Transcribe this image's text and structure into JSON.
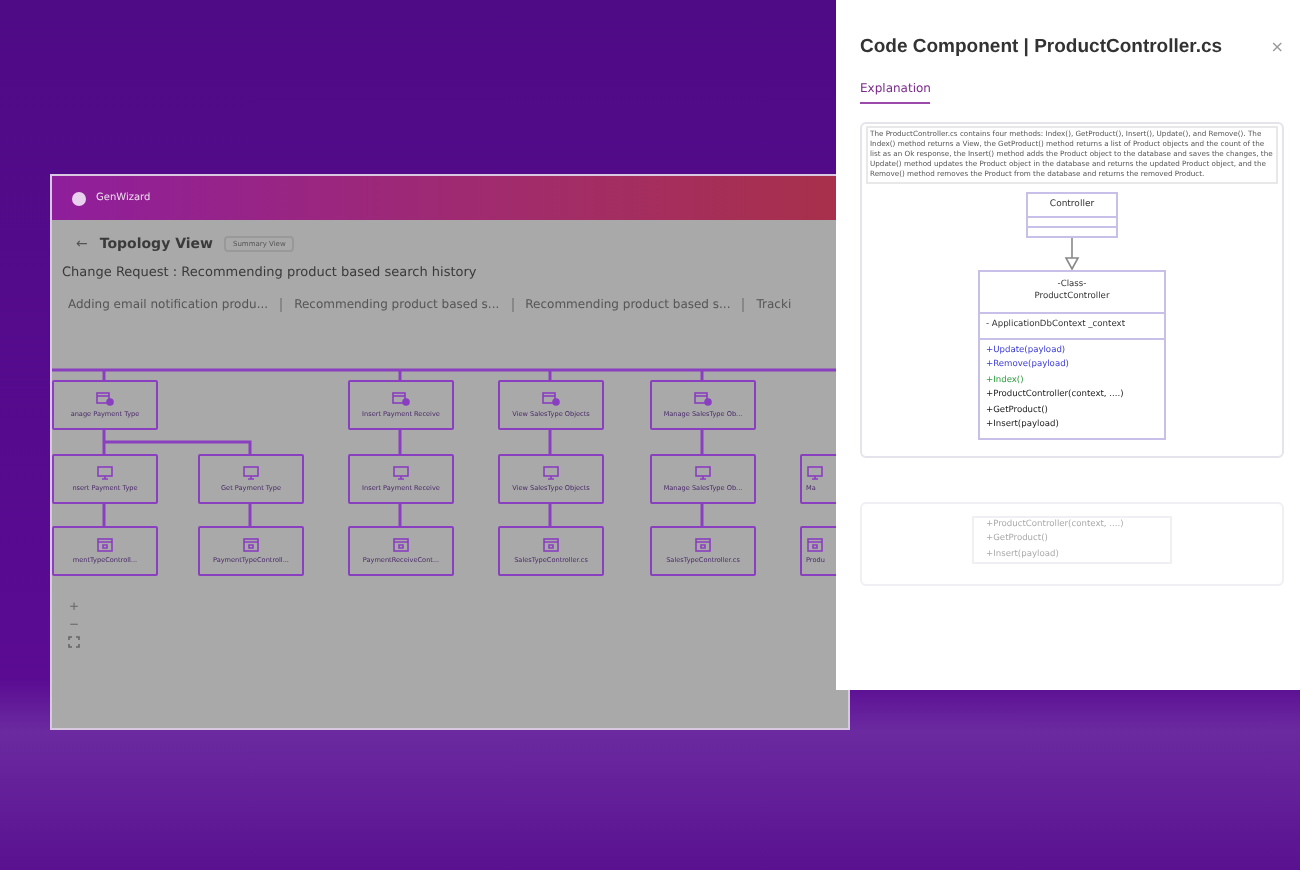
{
  "app": {
    "brand": "GenWizard",
    "back": "←",
    "view_title": "Topology View",
    "view_switch": "Summary View",
    "change_request": "Change Request : Recommending product based search history",
    "tabs": [
      {
        "label": "Adding email notification produ..."
      },
      {
        "label": "Recommending product based s..."
      },
      {
        "label": "Recommending product based s..."
      },
      {
        "label": "Tracki"
      }
    ],
    "diagram": {
      "columns": [
        {
          "nodes": [
            {
              "label": "anage Payment Type",
              "kind": "screen"
            },
            {
              "label": "nsert Payment Type",
              "kind": "page"
            },
            {
              "label": "mentTypeControll...",
              "kind": "file"
            }
          ]
        },
        {
          "nodes": [
            {
              "label": "Get Payment Type",
              "kind": "page"
            },
            {
              "label": "PaymentTypeControll...",
              "kind": "file"
            }
          ]
        },
        {
          "nodes": [
            {
              "label": "Insert Payment Receive",
              "kind": "screen"
            },
            {
              "label": "Insert Payment Receive",
              "kind": "page"
            },
            {
              "label": "PaymentReceiveCont...",
              "kind": "file"
            }
          ]
        },
        {
          "nodes": [
            {
              "label": "View SalesType Objects",
              "kind": "screen"
            },
            {
              "label": "View SalesType Objects",
              "kind": "page"
            },
            {
              "label": "SalesTypeController.cs",
              "kind": "file"
            }
          ]
        },
        {
          "nodes": [
            {
              "label": "Manage SalesType Ob...",
              "kind": "screen"
            },
            {
              "label": "Manage SalesType Ob...",
              "kind": "page"
            },
            {
              "label": "SalesTypeController.cs",
              "kind": "file"
            }
          ]
        },
        {
          "nodes": [
            {
              "label": "Ma",
              "kind": "page"
            },
            {
              "label": "Produ",
              "kind": "file"
            }
          ]
        }
      ]
    },
    "zoom_in": "+",
    "zoom_out": "−"
  },
  "modal": {
    "title": "Code Component | ProductController.cs",
    "close": "×",
    "tabs": [
      {
        "label": "Explanation",
        "selected": true
      }
    ],
    "explanation": "The ProductController.cs contains four methods: Index(), GetProduct(), Insert(), Update(), and Remove(). The Index() method returns a View, the GetProduct() method returns a list of Product objects and the count of the list as an Ok response, the Insert() method adds the Product object to the database and saves the changes, the Update() method updates the Product object in the database and returns the updated Product object, and the Remove() method removes the Product from the database and returns the removed Product.",
    "uml": {
      "parent": "Controller",
      "stereotype": "-Class-",
      "class_name": "ProductController",
      "fields": [
        "- ApplicationDbContext _context"
      ],
      "methods": [
        {
          "text": "+Update(payload)",
          "kind": "updated"
        },
        {
          "text": "+Remove(payload)",
          "kind": "updated"
        },
        {
          "text": "+Index()",
          "kind": "added"
        },
        {
          "text": "+ProductController(context, ....)",
          "kind": "plain"
        },
        {
          "text": "+GetProduct()",
          "kind": "plain"
        },
        {
          "text": "+Insert(payload)",
          "kind": "plain"
        }
      ]
    },
    "faded_methods": [
      "+ProductController(context, ....)",
      "+GetProduct()",
      "+Insert(payload)"
    ]
  }
}
